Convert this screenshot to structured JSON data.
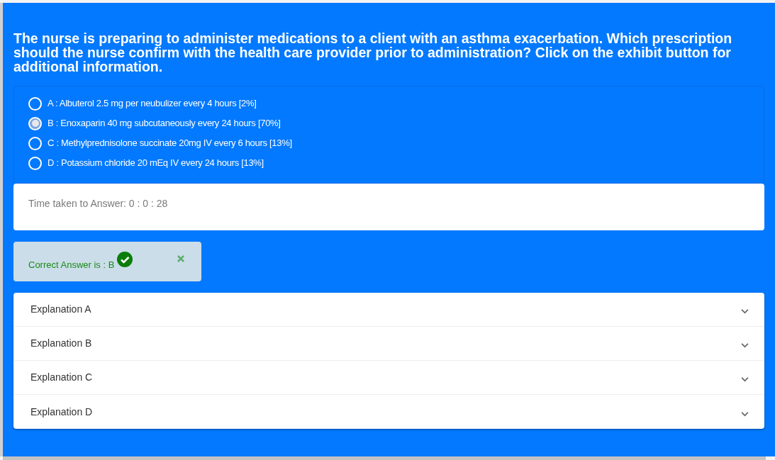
{
  "question": "The nurse is preparing to administer medications to a client with an asthma exacerbation. Which prescription should the nurse confirm with the health care provider prior to administration? Click on the exhibit button for additional information.",
  "options": [
    {
      "label": "A : Albuterol 2.5 mg per neubulizer every 4 hours [2%]",
      "selected": false
    },
    {
      "label": "B : Enoxaparin 40 mg subcutaneously every 24 hours [70%]",
      "selected": true
    },
    {
      "label": "C : Methylprednisolone succinate 20mg IV every 6 hours [13%]",
      "selected": false
    },
    {
      "label": "D : Potassium chloride 20 mEq IV every 24 hours [13%]",
      "selected": false
    }
  ],
  "time_taken": "Time taken to Answer: 0 : 0 : 28",
  "result": {
    "text": "Correct Answer is : B",
    "correct": true
  },
  "explanations": [
    {
      "label": "Explanation A",
      "expanded": false
    },
    {
      "label": "Explanation B",
      "expanded": false
    },
    {
      "label": "Explanation C",
      "expanded": false
    },
    {
      "label": "Explanation D",
      "expanded": false
    }
  ]
}
